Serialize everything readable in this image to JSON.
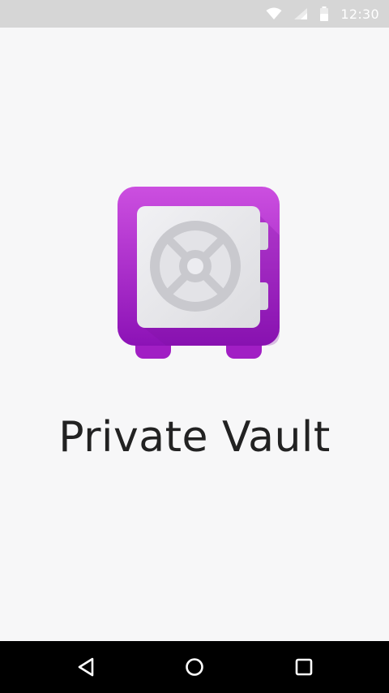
{
  "status_bar": {
    "time": "12:30",
    "icons": [
      "wifi-icon",
      "cellular-signal-icon",
      "battery-icon"
    ]
  },
  "app": {
    "title": "Private Vault",
    "logo_icon": "vault-safe-icon",
    "colors": {
      "logo_gradient_start": "#cc4fe0",
      "logo_gradient_end": "#8c12b6",
      "door": "#e7e7eb",
      "dial": "#cfcfd3"
    }
  },
  "nav_bar": {
    "icons": [
      "back-icon",
      "home-icon",
      "recents-icon"
    ]
  }
}
